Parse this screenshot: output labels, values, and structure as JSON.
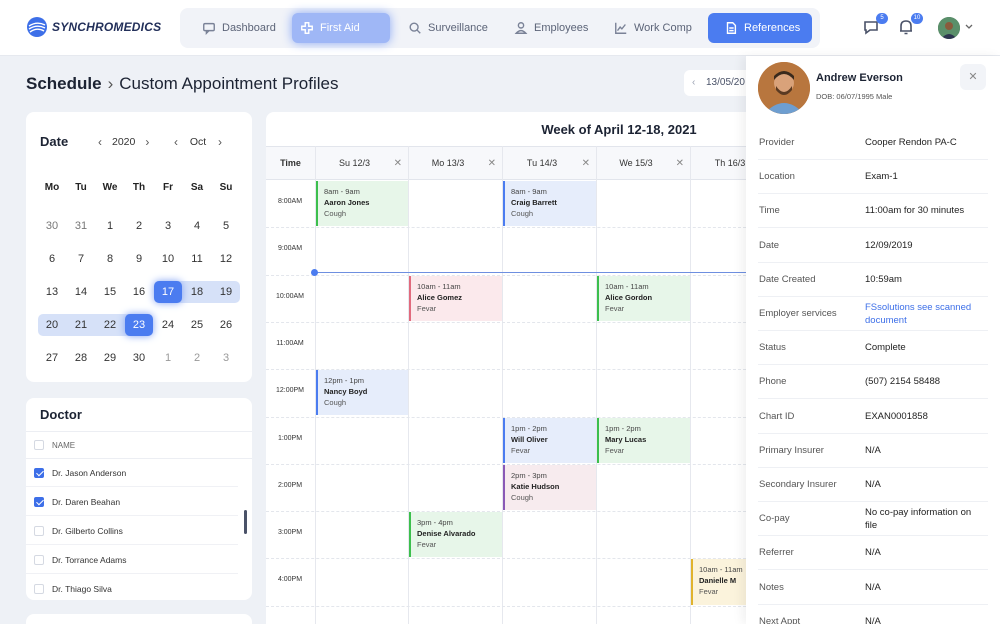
{
  "brand": {
    "name": "SYNCHROMEDICS"
  },
  "nav": [
    {
      "label": "Dashboard",
      "icon": "chat-icon"
    },
    {
      "label": "First Aid",
      "icon": "medical-cross-icon"
    },
    {
      "label": "Surveillance",
      "icon": "search-icon"
    },
    {
      "label": "Employees",
      "icon": "user-icon"
    },
    {
      "label": "Work Comp",
      "icon": "chart-icon"
    },
    {
      "label": "References",
      "icon": "document-icon"
    }
  ],
  "notifications": {
    "messages": "5",
    "alerts": "10"
  },
  "page": {
    "title": "Schedule",
    "subtitle": "Custom Appointment Profiles",
    "date_pill": "13/05/20"
  },
  "calendar": {
    "title": "Date",
    "year": "2020",
    "month": "Oct",
    "weekdays": [
      "Mo",
      "Tu",
      "We",
      "Th",
      "Fr",
      "Sa",
      "Su"
    ],
    "weeks": [
      [
        "30",
        "31",
        "1",
        "2",
        "3",
        "4",
        "5"
      ],
      [
        "6",
        "7",
        "8",
        "9",
        "10",
        "11",
        "12"
      ],
      [
        "13",
        "14",
        "15",
        "16",
        "17",
        "18",
        "19"
      ],
      [
        "20",
        "21",
        "22",
        "23",
        "24",
        "25",
        "26"
      ],
      [
        "27",
        "28",
        "29",
        "30",
        "1",
        "2",
        "3"
      ]
    ]
  },
  "doctors": {
    "title": "Doctor",
    "column": "NAME",
    "items": [
      {
        "name": "Dr. Jason Anderson",
        "checked": true
      },
      {
        "name": "Dr. Daren Beahan",
        "checked": true
      },
      {
        "name": "Dr. Gilberto Collins",
        "checked": false
      },
      {
        "name": "Dr. Torrance Adams",
        "checked": false
      },
      {
        "name": "Dr. Thiago Silva",
        "checked": false
      }
    ]
  },
  "schedule": {
    "week_title": "Week of April 12-18, 2021",
    "time_header": "Time",
    "days": [
      "Su 12/3",
      "Mo 13/3",
      "Tu 14/3",
      "We 15/3",
      "Th 16/3"
    ],
    "times": [
      "8:00AM",
      "9:00AM",
      "10:00AM",
      "11:00AM",
      "12:00PM",
      "1:00PM",
      "2:00PM",
      "3:00PM",
      "4:00PM"
    ],
    "events": [
      {
        "time": "8am - 9am",
        "name": "Aaron Jones",
        "reason": "Cough"
      },
      {
        "time": "8am - 9am",
        "name": "Craig Barrett",
        "reason": "Cough"
      },
      {
        "time": "10am - 11am",
        "name": "Alice Gomez",
        "reason": "Fevar"
      },
      {
        "time": "10am - 11am",
        "name": "Alice Gordon",
        "reason": "Fevar"
      },
      {
        "time": "12pm - 1pm",
        "name": "Nancy Boyd",
        "reason": "Cough"
      },
      {
        "time": "1pm - 2pm",
        "name": "Will Oliver",
        "reason": "Fevar"
      },
      {
        "time": "1pm - 2pm",
        "name": "Mary Lucas",
        "reason": "Fevar"
      },
      {
        "time": "2pm - 3pm",
        "name": "Katie Hudson",
        "reason": "Cough"
      },
      {
        "time": "3pm - 4pm",
        "name": "Denise Alvarado",
        "reason": "Fevar"
      },
      {
        "time": "10am - 11am",
        "name": "Danielle M",
        "reason": "Fevar"
      }
    ]
  },
  "patient": {
    "name": "Andrew Everson",
    "dob": "DOB: 06/07/1995 Male",
    "fields": [
      {
        "label": "Provider",
        "value": "Cooper Rendon PA-C"
      },
      {
        "label": "Location",
        "value": "Exam-1"
      },
      {
        "label": "Time",
        "value": "11:00am for 30 minutes"
      },
      {
        "label": "Date",
        "value": "12/09/2019"
      },
      {
        "label": "Date Created",
        "value": "10:59am"
      },
      {
        "label": "Employer services",
        "value": "FSsolutions see scanned document"
      },
      {
        "label": "Status",
        "value": "Complete"
      },
      {
        "label": "Phone",
        "value": "(507) 2154 58488"
      },
      {
        "label": "Chart ID",
        "value": "EXAN0001858"
      },
      {
        "label": "Primary Insurer",
        "value": "N/A"
      },
      {
        "label": "Secondary Insurer",
        "value": "N/A"
      },
      {
        "label": "Co-pay",
        "value": "No co-pay information on file"
      },
      {
        "label": "Referrer",
        "value": "N/A"
      },
      {
        "label": "Notes",
        "value": "N/A"
      },
      {
        "label": "Next Appt",
        "value": "N/A"
      }
    ]
  },
  "colors": {
    "accent": "#4b7cf0",
    "green": "#3cbf4d",
    "red": "#e16a7d",
    "purple": "#8a5ab6",
    "yellow": "#e0b32d"
  }
}
